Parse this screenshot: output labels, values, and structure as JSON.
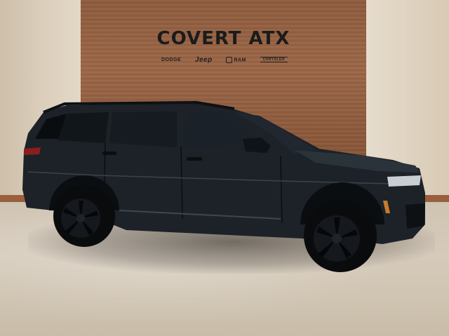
{
  "dealership": {
    "name": "COVERT ATX",
    "brands": [
      "DODGE",
      "Jeep",
      "RAM",
      "CHRYSLER"
    ]
  },
  "colors": {
    "vehicle_body": "#1c2228",
    "wood_panel": "#8d5a3c",
    "wall": "#ddd0bd",
    "floor": "#d2c6b5"
  }
}
